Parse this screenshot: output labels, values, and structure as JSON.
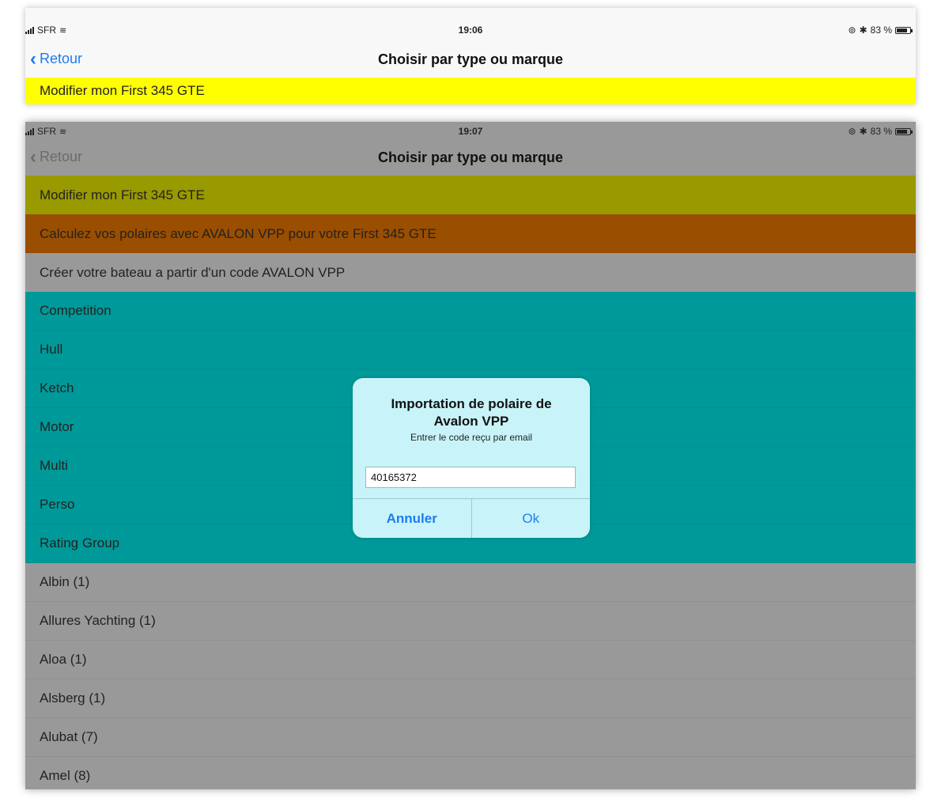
{
  "screen1": {
    "status": {
      "carrier": "SFR",
      "time": "19:06",
      "battery": "83 %",
      "battery_level": 0.83
    },
    "nav": {
      "back_label": "Retour",
      "title": "Choisir par type ou marque"
    },
    "rows": [
      "Modifier mon First 345 GTE"
    ]
  },
  "screen2": {
    "status": {
      "carrier": "SFR",
      "time": "19:07",
      "battery": "83 %",
      "battery_level": 0.83
    },
    "nav": {
      "back_label": "Retour",
      "title": "Choisir par type ou marque"
    },
    "actions": [
      "Modifier mon First 345 GTE",
      "Calculez vos polaires avec AVALON VPP pour votre First 345 GTE",
      "Créer votre bateau a partir d'un code AVALON VPP"
    ],
    "types": [
      "Competition",
      "Hull",
      "Ketch",
      "Motor",
      "Multi",
      "Perso",
      "Rating Group"
    ],
    "brands": [
      "Albin (1)",
      "Allures Yachting (1)",
      "Aloa (1)",
      "Alsberg (1)",
      "Alubat (7)",
      "Amel (8)"
    ]
  },
  "dialog": {
    "title": "Importation de polaire de Avalon VPP",
    "message": "Entrer le code reçu par email",
    "input_value": "40165372",
    "cancel_label": "Annuler",
    "ok_label": "Ok"
  },
  "colors": {
    "accent": "#1e7cf2",
    "yellow": "#ffff00",
    "teal_dimmed": "#009999",
    "orange_dimmed": "#9a4e00",
    "overlay_grey": "#999999",
    "dialog_bg": "#c8f4f9"
  }
}
